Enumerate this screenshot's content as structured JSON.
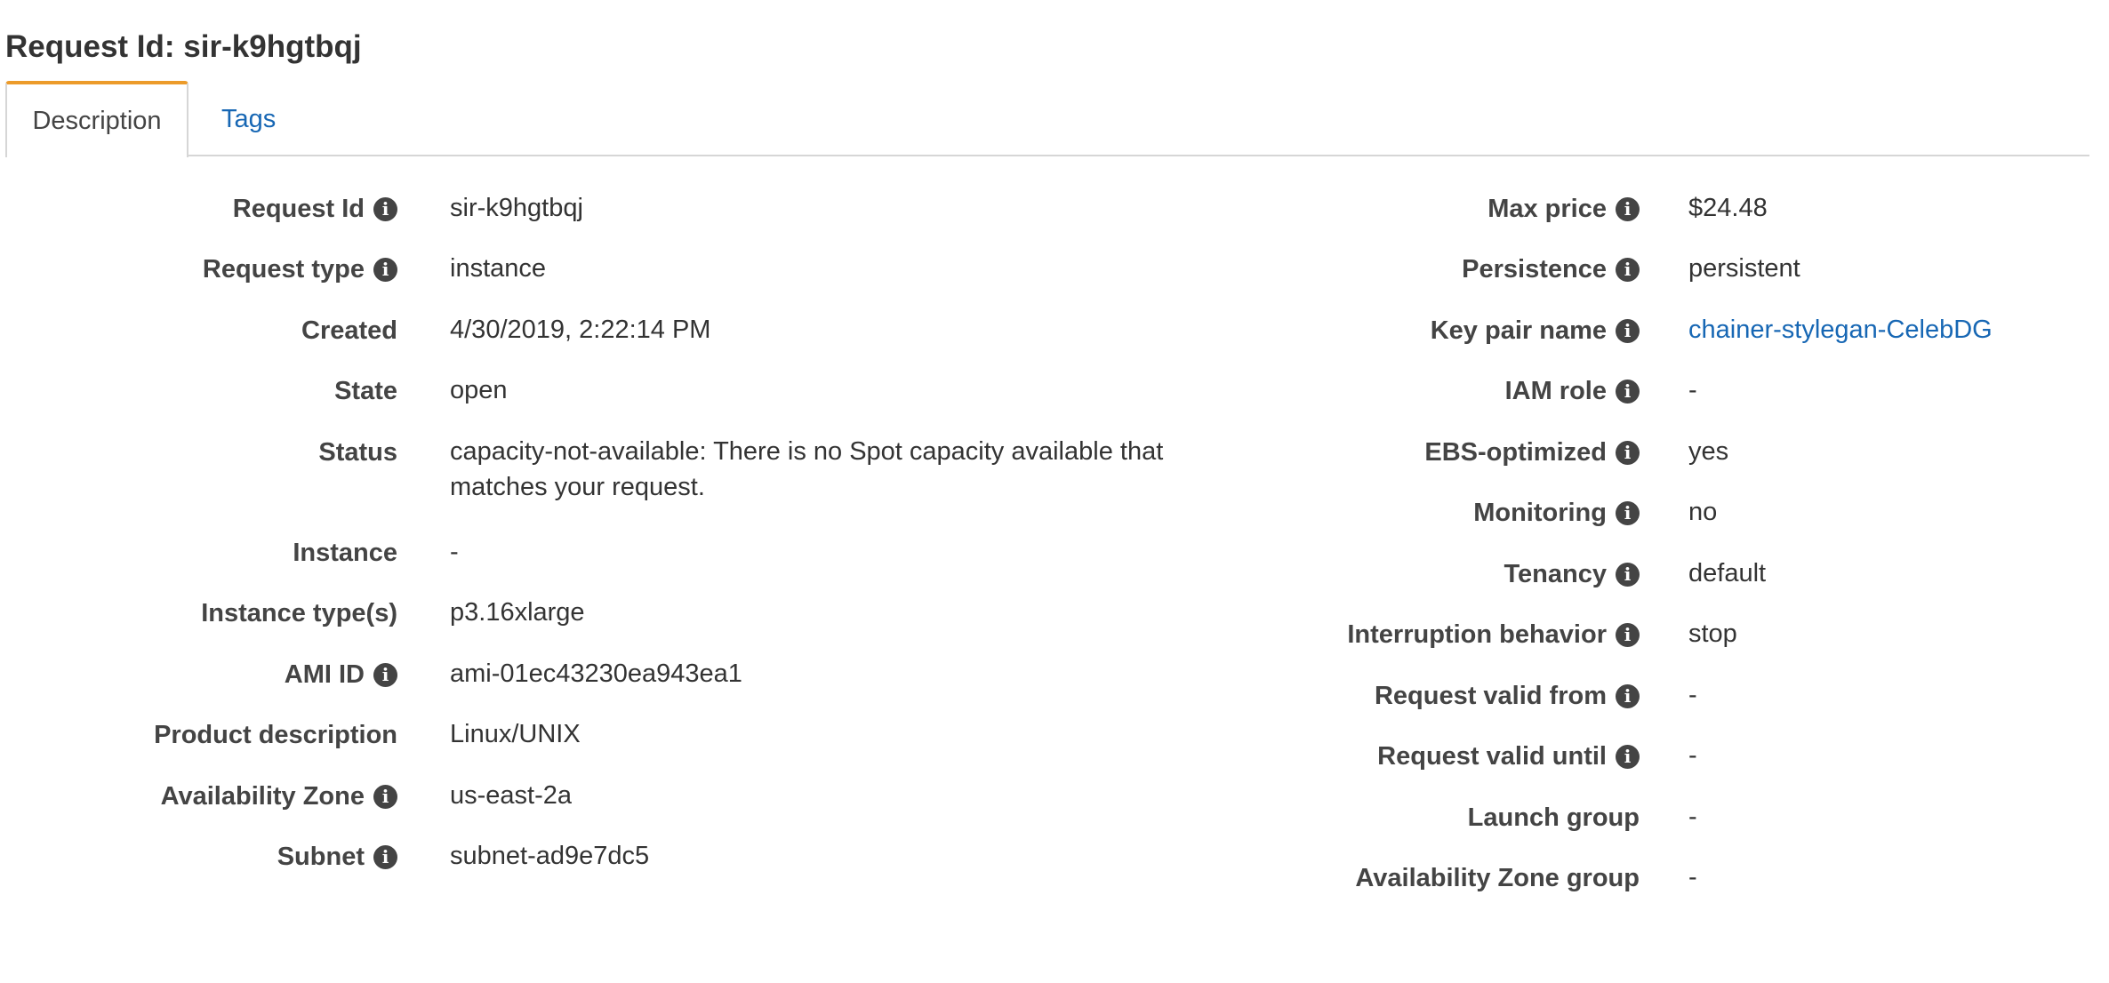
{
  "page": {
    "title": "Request Id: sir-k9hgtbqj"
  },
  "tabs": [
    {
      "label": "Description",
      "active": true
    },
    {
      "label": "Tags",
      "active": false
    }
  ],
  "colors": {
    "tab_accent": "#ec9b2a",
    "link": "#1767b4",
    "text": "#333333",
    "border": "#d6d6d6"
  },
  "info_icon_glyph": "i",
  "left_fields": [
    {
      "label": "Request Id",
      "value": "sir-k9hgtbqj",
      "info": true
    },
    {
      "label": "Request type",
      "value": "instance",
      "info": true
    },
    {
      "label": "Created",
      "value": "4/30/2019, 2:22:14 PM",
      "info": false
    },
    {
      "label": "State",
      "value": "open",
      "info": false
    },
    {
      "label": "Status",
      "value": "capacity-not-available: There is no Spot capacity available that matches your request.",
      "info": false
    },
    {
      "label": "Instance",
      "value": "-",
      "info": false
    },
    {
      "label": "Instance type(s)",
      "value": "p3.16xlarge",
      "info": false
    },
    {
      "label": "AMI ID",
      "value": "ami-01ec43230ea943ea1",
      "info": true
    },
    {
      "label": "Product description",
      "value": "Linux/UNIX",
      "info": false
    },
    {
      "label": "Availability Zone",
      "value": "us-east-2a",
      "info": true
    },
    {
      "label": "Subnet",
      "value": "subnet-ad9e7dc5",
      "info": true
    }
  ],
  "right_fields": [
    {
      "label": "Max price",
      "value": "$24.48",
      "info": true
    },
    {
      "label": "Persistence",
      "value": "persistent",
      "info": true
    },
    {
      "label": "Key pair name",
      "value": "chainer-stylegan-CelebDG",
      "info": true,
      "link": true
    },
    {
      "label": "IAM role",
      "value": "-",
      "info": true
    },
    {
      "label": "EBS-optimized",
      "value": "yes",
      "info": true
    },
    {
      "label": "Monitoring",
      "value": "no",
      "info": true
    },
    {
      "label": "Tenancy",
      "value": "default",
      "info": true
    },
    {
      "label": "Interruption behavior",
      "value": "stop",
      "info": true
    },
    {
      "label": "Request valid from",
      "value": "-",
      "info": true
    },
    {
      "label": "Request valid until",
      "value": "-",
      "info": true
    },
    {
      "label": "Launch group",
      "value": "-",
      "info": false
    },
    {
      "label": "Availability Zone group",
      "value": "-",
      "info": false
    }
  ]
}
